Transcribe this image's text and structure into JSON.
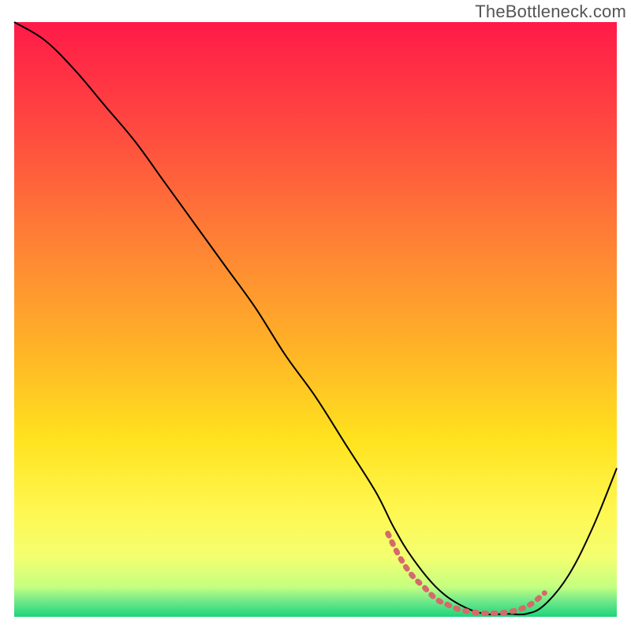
{
  "watermark": "TheBottleneck.com",
  "chart_data": {
    "type": "line",
    "title": "",
    "xlabel": "",
    "ylabel": "",
    "xlim": [
      0,
      100
    ],
    "ylim": [
      0,
      100
    ],
    "legend": false,
    "grid": false,
    "background": {
      "type": "vertical-gradient",
      "stops": [
        {
          "pos": 0.0,
          "color": "#ff1a48"
        },
        {
          "pos": 0.2,
          "color": "#ff4f3f"
        },
        {
          "pos": 0.4,
          "color": "#ff8a33"
        },
        {
          "pos": 0.55,
          "color": "#ffb327"
        },
        {
          "pos": 0.7,
          "color": "#ffe21e"
        },
        {
          "pos": 0.82,
          "color": "#fff750"
        },
        {
          "pos": 0.9,
          "color": "#f3ff70"
        },
        {
          "pos": 0.95,
          "color": "#c4ff80"
        },
        {
          "pos": 0.975,
          "color": "#6be88a"
        },
        {
          "pos": 1.0,
          "color": "#1fd37a"
        }
      ]
    },
    "series": [
      {
        "name": "bottleneck-curve",
        "color": "#000000",
        "width": 2,
        "x": [
          0,
          5,
          10,
          15,
          20,
          25,
          30,
          35,
          40,
          45,
          50,
          55,
          60,
          63,
          66,
          70,
          74,
          78,
          82,
          85,
          88,
          92,
          96,
          100
        ],
        "y": [
          100,
          97,
          92,
          86,
          80,
          73,
          66,
          59,
          52,
          44,
          37,
          29,
          21,
          15,
          10,
          5,
          2,
          0.5,
          0.5,
          0.5,
          2,
          7,
          15,
          25
        ]
      },
      {
        "name": "optimal-zone-marker",
        "color": "#d46a6a",
        "width": 7,
        "dash": [
          3,
          9
        ],
        "linecap": "round",
        "x": [
          62,
          64,
          66,
          68,
          70,
          72,
          74,
          76,
          78,
          80,
          82,
          84,
          86,
          88
        ],
        "y": [
          14,
          10,
          7,
          5,
          3,
          2,
          1.2,
          0.8,
          0.6,
          0.6,
          0.8,
          1.3,
          2.3,
          4
        ]
      }
    ]
  }
}
